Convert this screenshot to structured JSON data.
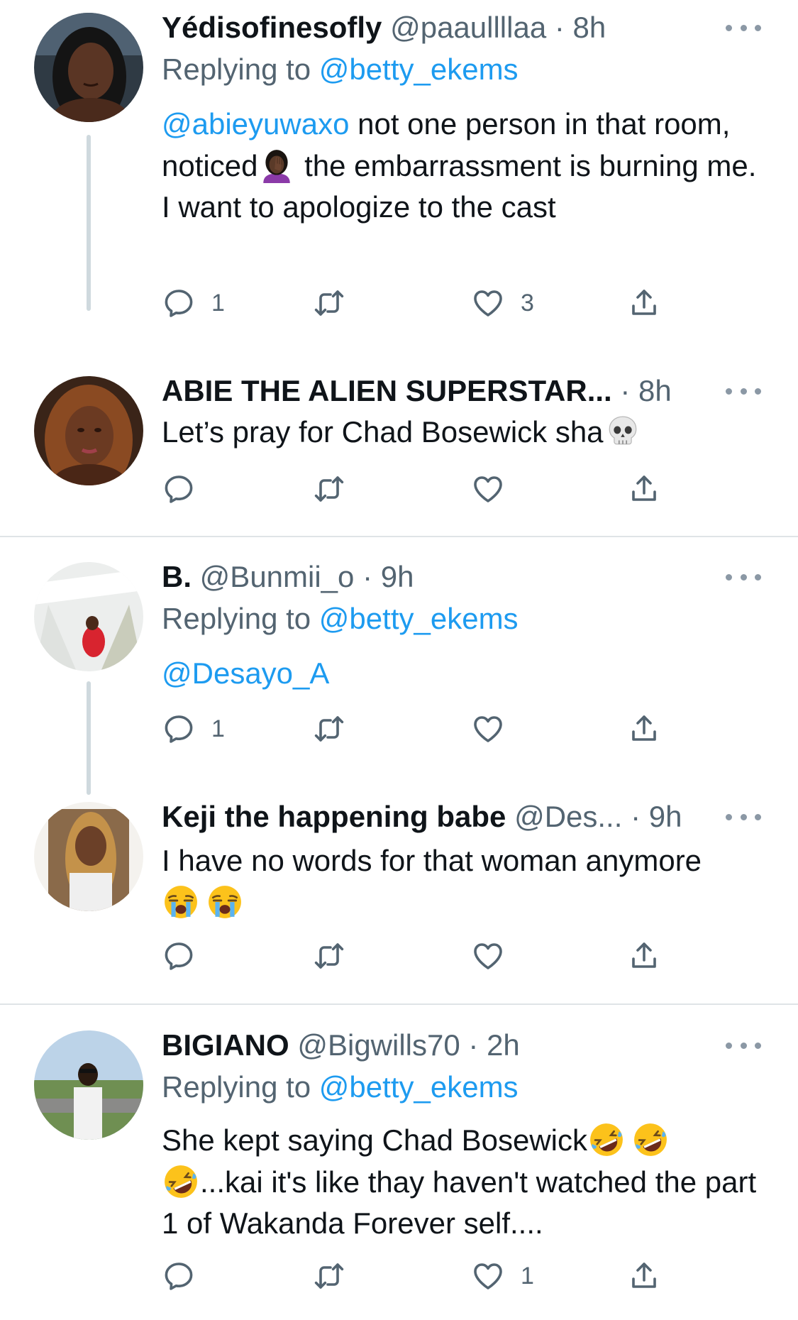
{
  "icons": {
    "reply": "comment-icon",
    "retweet": "retweet-icon",
    "like": "heart-icon",
    "share": "share-icon",
    "more": "more-options-icon"
  },
  "colors": {
    "link": "#1d9bf0",
    "secondary": "#536471",
    "icon": "#536471",
    "divider": "#dfe4e7",
    "thread": "#cfd9de"
  },
  "tweets": [
    {
      "name": "Yédisofinesofly",
      "handle": "@paaullllaa",
      "separator": "·",
      "time": "8h",
      "replying_prefix": "Replying to ",
      "replying_to": "@betty_ekems",
      "mention": "@abieyuwaxo",
      "text_1": " not one person in that room, noticed",
      "text_2": " the embarrassment is burning me. I want to apologize to the cast",
      "emoji_1": "facepalm-emoji",
      "reply_count": "1",
      "retweet_count": "",
      "like_count": "3"
    },
    {
      "name": "ABIE THE ALIEN SUPERSTAR...",
      "handle": "",
      "separator": "·",
      "time": "8h",
      "text": "Let’s pray for Chad Bosewick sha",
      "emoji_1": "skull-emoji",
      "reply_count": "",
      "retweet_count": "",
      "like_count": ""
    },
    {
      "name": "B.",
      "handle": "@Bunmii_o",
      "separator": "·",
      "time": "9h",
      "replying_prefix": "Replying to ",
      "replying_to": "@betty_ekems",
      "mention": "@Desayo_A",
      "reply_count": "1",
      "retweet_count": "",
      "like_count": ""
    },
    {
      "name": "Keji the happening babe",
      "handle": "@Des...",
      "separator": "·",
      "time": "9h",
      "text": "I have no words for that woman anymore",
      "emoji_1": "loudly-crying-emoji",
      "emoji_2": "loudly-crying-emoji",
      "reply_count": "",
      "retweet_count": "",
      "like_count": ""
    },
    {
      "name": "BIGIANO",
      "handle": "@Bigwills70",
      "separator": "·",
      "time": "2h",
      "replying_prefix": "Replying to ",
      "replying_to": "@betty_ekems",
      "text_1": "She kept saying Chad Bosewick",
      "text_2": "...kai it's like thay haven't watched the part 1 of Wakanda Forever self....",
      "emoji_1": "rolling-laughing-emoji",
      "emoji_2": "rolling-laughing-emoji",
      "emoji_3": "rolling-laughing-emoji",
      "reply_count": "",
      "retweet_count": "",
      "like_count": "1"
    }
  ]
}
